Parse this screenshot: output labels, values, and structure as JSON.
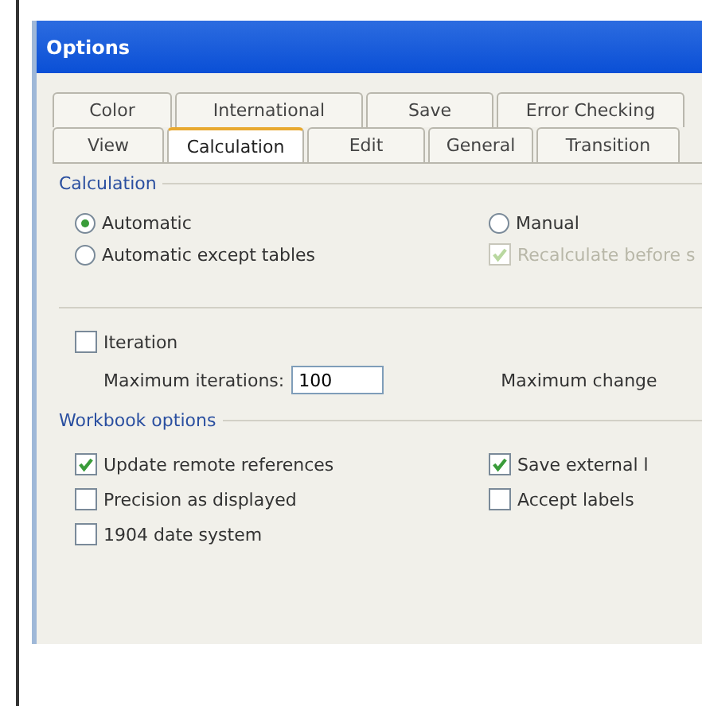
{
  "window": {
    "title": "Options"
  },
  "tab_rows": [
    [
      {
        "label": "Color",
        "selected": false
      },
      {
        "label": "International",
        "selected": false
      },
      {
        "label": "Save",
        "selected": false
      },
      {
        "label": "Error Checking",
        "selected": false
      }
    ],
    [
      {
        "label": "View",
        "selected": false
      },
      {
        "label": "Calculation",
        "selected": true
      },
      {
        "label": "Edit",
        "selected": false
      },
      {
        "label": "General",
        "selected": false
      },
      {
        "label": "Transition",
        "selected": false
      }
    ]
  ],
  "calculation": {
    "title": "Calculation",
    "options": [
      {
        "label": "Automatic",
        "selected": true
      },
      {
        "label": "Manual",
        "selected": false
      },
      {
        "label": "Automatic except tables",
        "selected": false
      }
    ],
    "recalculate": {
      "label": "Recalculate before s",
      "checked": true,
      "disabled": true
    },
    "iteration": {
      "label": "Iteration",
      "checked": false
    },
    "max_iterations": {
      "label": "Maximum iterations:",
      "value": "100"
    },
    "max_change": {
      "label": "Maximum change"
    }
  },
  "workbook": {
    "title": "Workbook options",
    "options": [
      {
        "label": "Update remote references",
        "checked": true
      },
      {
        "label": "Save external l",
        "checked": true
      },
      {
        "label": "Precision as displayed",
        "checked": false
      },
      {
        "label": "Accept labels",
        "checked": false
      },
      {
        "label": "1904 date system",
        "checked": false
      }
    ]
  }
}
